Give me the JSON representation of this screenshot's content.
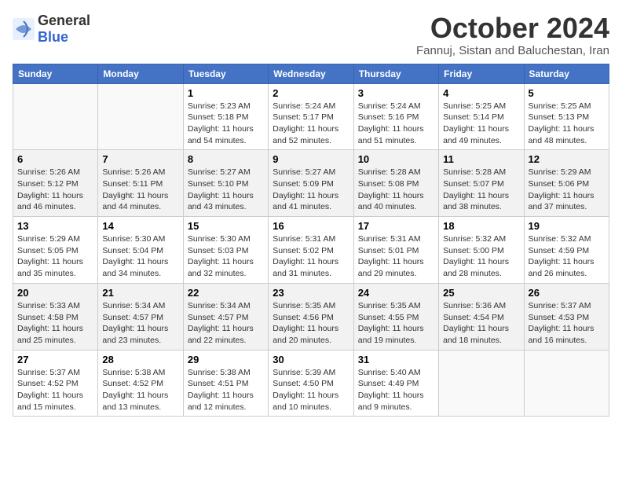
{
  "logo": {
    "text_general": "General",
    "text_blue": "Blue"
  },
  "title": {
    "month_year": "October 2024",
    "location": "Fannuj, Sistan and Baluchestan, Iran"
  },
  "days_of_week": [
    "Sunday",
    "Monday",
    "Tuesday",
    "Wednesday",
    "Thursday",
    "Friday",
    "Saturday"
  ],
  "weeks": [
    [
      {
        "day": "",
        "info": ""
      },
      {
        "day": "",
        "info": ""
      },
      {
        "day": "1",
        "info": "Sunrise: 5:23 AM\nSunset: 5:18 PM\nDaylight: 11 hours and 54 minutes."
      },
      {
        "day": "2",
        "info": "Sunrise: 5:24 AM\nSunset: 5:17 PM\nDaylight: 11 hours and 52 minutes."
      },
      {
        "day": "3",
        "info": "Sunrise: 5:24 AM\nSunset: 5:16 PM\nDaylight: 11 hours and 51 minutes."
      },
      {
        "day": "4",
        "info": "Sunrise: 5:25 AM\nSunset: 5:14 PM\nDaylight: 11 hours and 49 minutes."
      },
      {
        "day": "5",
        "info": "Sunrise: 5:25 AM\nSunset: 5:13 PM\nDaylight: 11 hours and 48 minutes."
      }
    ],
    [
      {
        "day": "6",
        "info": "Sunrise: 5:26 AM\nSunset: 5:12 PM\nDaylight: 11 hours and 46 minutes."
      },
      {
        "day": "7",
        "info": "Sunrise: 5:26 AM\nSunset: 5:11 PM\nDaylight: 11 hours and 44 minutes."
      },
      {
        "day": "8",
        "info": "Sunrise: 5:27 AM\nSunset: 5:10 PM\nDaylight: 11 hours and 43 minutes."
      },
      {
        "day": "9",
        "info": "Sunrise: 5:27 AM\nSunset: 5:09 PM\nDaylight: 11 hours and 41 minutes."
      },
      {
        "day": "10",
        "info": "Sunrise: 5:28 AM\nSunset: 5:08 PM\nDaylight: 11 hours and 40 minutes."
      },
      {
        "day": "11",
        "info": "Sunrise: 5:28 AM\nSunset: 5:07 PM\nDaylight: 11 hours and 38 minutes."
      },
      {
        "day": "12",
        "info": "Sunrise: 5:29 AM\nSunset: 5:06 PM\nDaylight: 11 hours and 37 minutes."
      }
    ],
    [
      {
        "day": "13",
        "info": "Sunrise: 5:29 AM\nSunset: 5:05 PM\nDaylight: 11 hours and 35 minutes."
      },
      {
        "day": "14",
        "info": "Sunrise: 5:30 AM\nSunset: 5:04 PM\nDaylight: 11 hours and 34 minutes."
      },
      {
        "day": "15",
        "info": "Sunrise: 5:30 AM\nSunset: 5:03 PM\nDaylight: 11 hours and 32 minutes."
      },
      {
        "day": "16",
        "info": "Sunrise: 5:31 AM\nSunset: 5:02 PM\nDaylight: 11 hours and 31 minutes."
      },
      {
        "day": "17",
        "info": "Sunrise: 5:31 AM\nSunset: 5:01 PM\nDaylight: 11 hours and 29 minutes."
      },
      {
        "day": "18",
        "info": "Sunrise: 5:32 AM\nSunset: 5:00 PM\nDaylight: 11 hours and 28 minutes."
      },
      {
        "day": "19",
        "info": "Sunrise: 5:32 AM\nSunset: 4:59 PM\nDaylight: 11 hours and 26 minutes."
      }
    ],
    [
      {
        "day": "20",
        "info": "Sunrise: 5:33 AM\nSunset: 4:58 PM\nDaylight: 11 hours and 25 minutes."
      },
      {
        "day": "21",
        "info": "Sunrise: 5:34 AM\nSunset: 4:57 PM\nDaylight: 11 hours and 23 minutes."
      },
      {
        "day": "22",
        "info": "Sunrise: 5:34 AM\nSunset: 4:57 PM\nDaylight: 11 hours and 22 minutes."
      },
      {
        "day": "23",
        "info": "Sunrise: 5:35 AM\nSunset: 4:56 PM\nDaylight: 11 hours and 20 minutes."
      },
      {
        "day": "24",
        "info": "Sunrise: 5:35 AM\nSunset: 4:55 PM\nDaylight: 11 hours and 19 minutes."
      },
      {
        "day": "25",
        "info": "Sunrise: 5:36 AM\nSunset: 4:54 PM\nDaylight: 11 hours and 18 minutes."
      },
      {
        "day": "26",
        "info": "Sunrise: 5:37 AM\nSunset: 4:53 PM\nDaylight: 11 hours and 16 minutes."
      }
    ],
    [
      {
        "day": "27",
        "info": "Sunrise: 5:37 AM\nSunset: 4:52 PM\nDaylight: 11 hours and 15 minutes."
      },
      {
        "day": "28",
        "info": "Sunrise: 5:38 AM\nSunset: 4:52 PM\nDaylight: 11 hours and 13 minutes."
      },
      {
        "day": "29",
        "info": "Sunrise: 5:38 AM\nSunset: 4:51 PM\nDaylight: 11 hours and 12 minutes."
      },
      {
        "day": "30",
        "info": "Sunrise: 5:39 AM\nSunset: 4:50 PM\nDaylight: 11 hours and 10 minutes."
      },
      {
        "day": "31",
        "info": "Sunrise: 5:40 AM\nSunset: 4:49 PM\nDaylight: 11 hours and 9 minutes."
      },
      {
        "day": "",
        "info": ""
      },
      {
        "day": "",
        "info": ""
      }
    ]
  ]
}
